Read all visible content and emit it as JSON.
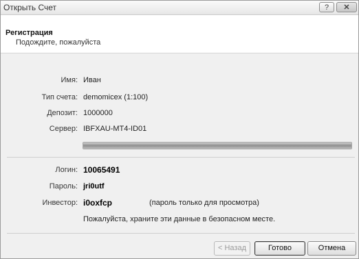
{
  "window": {
    "title": "Открыть Счет",
    "help_label": "?",
    "close_label": "✕"
  },
  "header": {
    "title": "Регистрация",
    "subtitle": "Подождите, пожалуйста"
  },
  "fields": {
    "name_label": "Имя:",
    "name_value": "Иван",
    "account_type_label": "Тип счета:",
    "account_type_value": "demomicex (1:100)",
    "deposit_label": "Депозит:",
    "deposit_value": "1000000",
    "server_label": "Сервер:",
    "server_value": "IBFXAU-MT4-ID01"
  },
  "progress": {
    "percent": 100
  },
  "credentials": {
    "login_label": "Логин:",
    "login_value": "10065491",
    "password_label": "Пароль:",
    "password_value": "jri0utf",
    "investor_label": "Инвестор:",
    "investor_value": "i0oxfcp",
    "investor_note": "(пароль только для просмотра)",
    "safety_note": "Пожалуйста, храните эти данные в безопасном месте."
  },
  "buttons": {
    "back": "< Назад",
    "finish": "Готово",
    "cancel": "Отмена"
  }
}
